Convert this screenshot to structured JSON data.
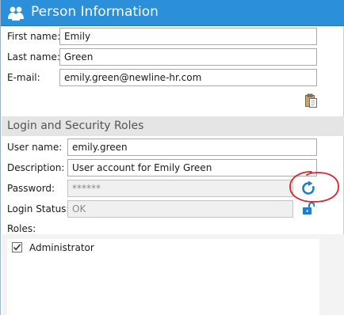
{
  "window": {
    "title": "Person Information",
    "title_icon": "people-icon",
    "accent_color": "#2b8fd9"
  },
  "person": {
    "first_name_label": "First name:",
    "first_name_value": "Emily",
    "last_name_label": "Last name:",
    "last_name_value": "Green",
    "email_label": "E-mail:",
    "email_value": "emily.green@newline-hr.com",
    "paste_icon": "clipboard-icon"
  },
  "login": {
    "section_title": "Login and Security Roles",
    "username_label": "User name:",
    "username_value": "emily.green",
    "description_label": "Description:",
    "description_value": "User account for Emily Green",
    "password_label": "Password:",
    "password_value": "******",
    "reset_icon": "refresh-icon",
    "login_status_label": "Login Status:",
    "login_status_value": "OK",
    "lock_icon": "unlock-icon"
  },
  "roles": {
    "label": "Roles:",
    "items": [
      {
        "name": "Administrator",
        "checked": true
      }
    ]
  },
  "annotation": {
    "shape": "hand-drawn circle",
    "color": "#d9262b"
  }
}
